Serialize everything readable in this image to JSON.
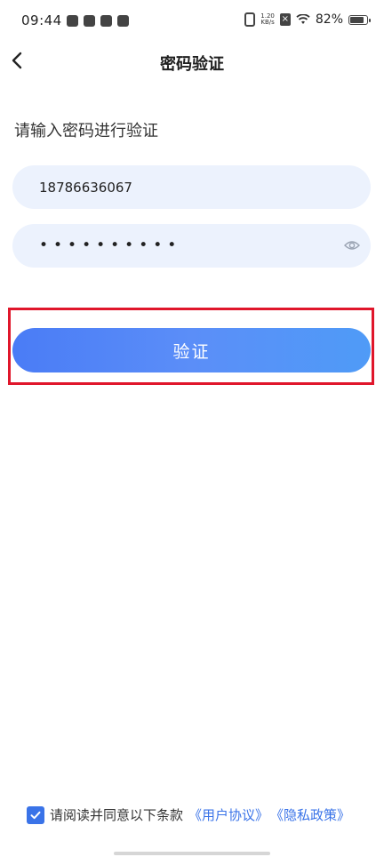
{
  "status_bar": {
    "time": "09:44",
    "net_speed_value": "1.20",
    "net_speed_unit": "KB/s",
    "battery_percent": "82%",
    "battery_level": 0.82
  },
  "header": {
    "title": "密码验证",
    "back_icon": "chevron-left-icon"
  },
  "form": {
    "prompt": "请输入密码进行验证",
    "phone_value": "18786636067",
    "password_mask": "••••••••••",
    "eye_icon": "eye-icon"
  },
  "verify_button": {
    "label": "验证"
  },
  "agreement": {
    "checked": true,
    "text": "请阅读并同意以下条款",
    "user_agreement": "《用户协议》",
    "privacy_policy": "《隐私政策》"
  },
  "colors": {
    "accent": "#3a73e8",
    "input_bg": "#ecf2fd",
    "highlight_border": "#e0162b"
  }
}
